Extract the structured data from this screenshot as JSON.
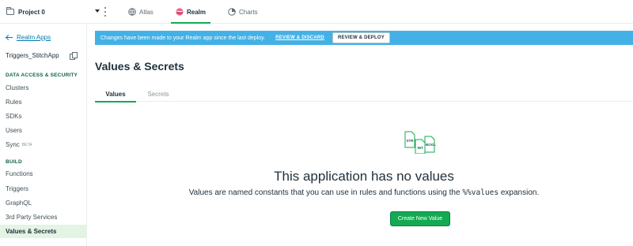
{
  "topnav": {
    "project": "Project 0",
    "tabs": [
      {
        "label": "Atlas",
        "icon": "atlas-icon",
        "active": false
      },
      {
        "label": "Realm",
        "icon": "realm-icon",
        "active": true
      },
      {
        "label": "Charts",
        "icon": "charts-icon",
        "active": false
      }
    ]
  },
  "sidebar": {
    "back_label": "Realm Apps",
    "app_name": "Triggers_StitchApp",
    "section1": "DATA ACCESS & SECURITY",
    "items1": [
      "Clusters",
      "Rules",
      "SDKs",
      "Users",
      "Sync"
    ],
    "sync_badge": "BETA",
    "section2": "BUILD",
    "items2": [
      "Functions",
      "Triggers",
      "GraphQL",
      "3rd Party Services",
      "Values & Secrets"
    ]
  },
  "banner": {
    "message": "Changes have been made to your Realm app since the last deploy.",
    "discard_label": "REVIEW & DISCARD",
    "deploy_label": "REVIEW & DEPLOY"
  },
  "page": {
    "title": "Values & Secrets",
    "tabs": [
      "Values",
      "Secrets"
    ]
  },
  "empty": {
    "illus_labels": [
      "STR",
      "INT",
      "BOOL"
    ],
    "title": "This application has no values",
    "desc_before": "Values are named constants that you can use in rules and functions using the ",
    "desc_code": "%%values",
    "desc_after": " expansion.",
    "button": "Create New Value"
  },
  "colors": {
    "accent_green": "#13aa52",
    "banner_blue": "#43b1e5",
    "link_blue": "#007cad",
    "active_bg": "#e4f4e4"
  }
}
